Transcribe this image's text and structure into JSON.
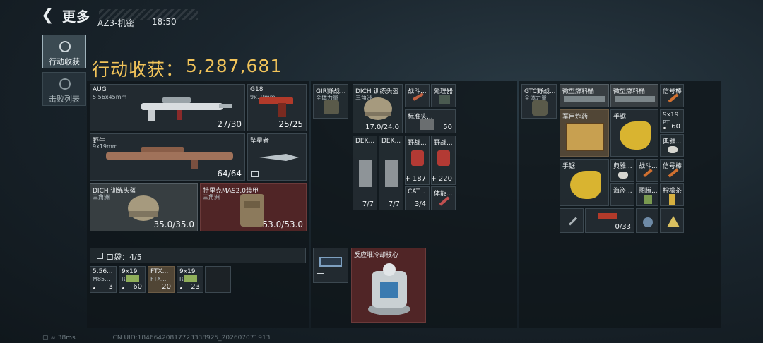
{
  "topbar": {
    "back_icon": "chevron-left-icon",
    "title": "更多"
  },
  "nav": {
    "tab_harvest": {
      "label": "行动收获",
      "icon": "target-icon"
    },
    "tab_kills": {
      "label": "击败列表",
      "icon": "skull-icon"
    }
  },
  "header": {
    "map": "AZ3-机密",
    "time": "18:50",
    "harvest_label": "行动收获：",
    "harvest_value": "5,287,681"
  },
  "weapons": {
    "aug": {
      "name": "AUG",
      "caliber": "5.56x45mm",
      "ammo": "27/30"
    },
    "g18": {
      "name": "G18",
      "caliber": "9x19mm",
      "ammo": "25/25"
    },
    "yeniu": {
      "name": "野牛",
      "caliber": "9x19mm",
      "ammo": "64/64"
    },
    "knife": {
      "name": "坠星者"
    }
  },
  "armor": {
    "helmet": {
      "name": "DICH 训练头盔",
      "sub": "三角洲",
      "durability": "35.0/35.0"
    },
    "vest": {
      "name": "特里克MAS2.0装甲",
      "sub": "三角洲",
      "durability": "53.0/53.0"
    }
  },
  "pocket": {
    "label": "口袋：4/5",
    "items": [
      {
        "name": "5.56...",
        "sub": "M85...",
        "count": "3"
      },
      {
        "name": "9x19",
        "sub": "R...",
        "count": "60"
      },
      {
        "name": "FTX...",
        "sub": "FTX...",
        "count": "20"
      },
      {
        "name": "9x19",
        "sub": "R...",
        "count": "23"
      }
    ]
  },
  "middle": {
    "chest_rig": {
      "name": "GIR野战...",
      "sub": "全体力量"
    },
    "bag_helmet": {
      "name": "DICH 训练头盔",
      "sub": "三角洲",
      "durability": "17.0/24.0"
    },
    "knife2": {
      "name": "战斗..."
    },
    "processor": {
      "name": "处理器"
    },
    "standard": {
      "name": "标准头...",
      "count": "50"
    },
    "dek1": {
      "name": "DEK...",
      "count": "7/7"
    },
    "dek2": {
      "name": "DEK...",
      "count": "7/7"
    },
    "field1": {
      "name": "野战...",
      "count": "+ 187"
    },
    "field2": {
      "name": "野战...",
      "count": "+ 220"
    },
    "cat": {
      "name": "CAT...",
      "count": "3/4"
    },
    "energy": {
      "name": "体能..."
    },
    "safe_box_icon": "lock-box-icon",
    "reactor": {
      "name": "反应堆冷却核心"
    }
  },
  "backpack": {
    "gtc": {
      "name": "GTC野战...",
      "sub": "全体力量"
    },
    "fuel1": {
      "name": "微型燃料桶"
    },
    "fuel2": {
      "name": "微型燃料桶"
    },
    "flare1": {
      "name": "信号棒"
    },
    "explosive": {
      "name": "军用炸药"
    },
    "saw1": {
      "name": "手锯"
    },
    "ammo919": {
      "name": "9x19",
      "sub": "PT...",
      "count": "60"
    },
    "classic1": {
      "name": "典雅..."
    },
    "saw2": {
      "name": "手锯"
    },
    "classic2": {
      "name": "典雅..."
    },
    "combat": {
      "name": "战斗..."
    },
    "flare2": {
      "name": "信号棒"
    },
    "seashell": {
      "name": "海盗..."
    },
    "book": {
      "name": "图腾..."
    },
    "lemon": {
      "name": "柠檬茶"
    },
    "pistol_count": "0/33"
  },
  "footer": {
    "ping": "38ms",
    "uid": "CN UID:18466420817723338925_202607071913"
  },
  "colors": {
    "gold": "#f2c45a",
    "red_cell": "#5c2828",
    "brown_cell": "#5c4e3a"
  }
}
